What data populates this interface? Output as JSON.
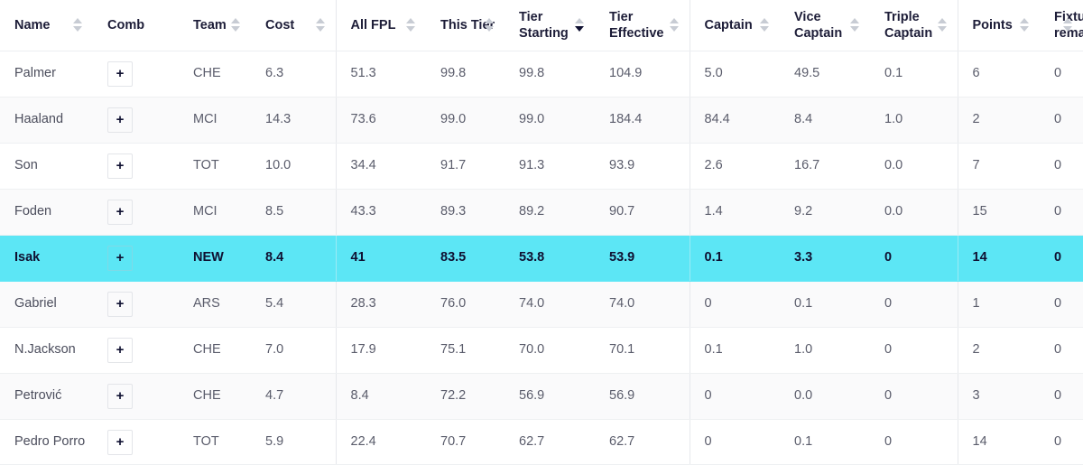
{
  "table": {
    "columns": [
      {
        "label": "Name",
        "sort": "none",
        "divider": false
      },
      {
        "label": "Comb",
        "sort": null,
        "divider": false
      },
      {
        "label": "Team",
        "sort": "none",
        "divider": false
      },
      {
        "label": "Cost",
        "sort": "none",
        "divider": true
      },
      {
        "label": "All FPL",
        "sort": "none",
        "divider": false
      },
      {
        "label": "This Tier",
        "sort": "none",
        "divider": false
      },
      {
        "label": "Tier\nStarting",
        "sort": "desc",
        "divider": false
      },
      {
        "label": "Tier\nEffective",
        "sort": "none",
        "divider": true
      },
      {
        "label": "Captain",
        "sort": "none",
        "divider": false
      },
      {
        "label": "Vice\nCaptain",
        "sort": "none",
        "divider": false
      },
      {
        "label": "Triple\nCaptain",
        "sort": "none",
        "divider": true
      },
      {
        "label": "Points",
        "sort": "none",
        "divider": false
      },
      {
        "label": "Fixtures\nremaining",
        "sort": "none",
        "divider": false
      }
    ],
    "add_button_label": "+",
    "highlight_color": "#5ce6f5",
    "rows": [
      {
        "name": "Palmer",
        "team": "CHE",
        "cost": "6.3",
        "all_fpl": "51.3",
        "this_tier": "99.8",
        "tier_starting": "99.8",
        "tier_effective": "104.9",
        "captain": "5.0",
        "vice_captain": "49.5",
        "triple_captain": "0.1",
        "points": "6",
        "fixtures_remaining": "0",
        "highlighted": false
      },
      {
        "name": "Haaland",
        "team": "MCI",
        "cost": "14.3",
        "all_fpl": "73.6",
        "this_tier": "99.0",
        "tier_starting": "99.0",
        "tier_effective": "184.4",
        "captain": "84.4",
        "vice_captain": "8.4",
        "triple_captain": "1.0",
        "points": "2",
        "fixtures_remaining": "0",
        "highlighted": false
      },
      {
        "name": "Son",
        "team": "TOT",
        "cost": "10.0",
        "all_fpl": "34.4",
        "this_tier": "91.7",
        "tier_starting": "91.3",
        "tier_effective": "93.9",
        "captain": "2.6",
        "vice_captain": "16.7",
        "triple_captain": "0.0",
        "points": "7",
        "fixtures_remaining": "0",
        "highlighted": false
      },
      {
        "name": "Foden",
        "team": "MCI",
        "cost": "8.5",
        "all_fpl": "43.3",
        "this_tier": "89.3",
        "tier_starting": "89.2",
        "tier_effective": "90.7",
        "captain": "1.4",
        "vice_captain": "9.2",
        "triple_captain": "0.0",
        "points": "15",
        "fixtures_remaining": "0",
        "highlighted": false
      },
      {
        "name": "Isak",
        "team": "NEW",
        "cost": "8.4",
        "all_fpl": "41",
        "this_tier": "83.5",
        "tier_starting": "53.8",
        "tier_effective": "53.9",
        "captain": "0.1",
        "vice_captain": "3.3",
        "triple_captain": "0",
        "points": "14",
        "fixtures_remaining": "0",
        "highlighted": true
      },
      {
        "name": "Gabriel",
        "team": "ARS",
        "cost": "5.4",
        "all_fpl": "28.3",
        "this_tier": "76.0",
        "tier_starting": "74.0",
        "tier_effective": "74.0",
        "captain": "0",
        "vice_captain": "0.1",
        "triple_captain": "0",
        "points": "1",
        "fixtures_remaining": "0",
        "highlighted": false
      },
      {
        "name": "N.Jackson",
        "team": "CHE",
        "cost": "7.0",
        "all_fpl": "17.9",
        "this_tier": "75.1",
        "tier_starting": "70.0",
        "tier_effective": "70.1",
        "captain": "0.1",
        "vice_captain": "1.0",
        "triple_captain": "0",
        "points": "2",
        "fixtures_remaining": "0",
        "highlighted": false
      },
      {
        "name": "Petrović",
        "team": "CHE",
        "cost": "4.7",
        "all_fpl": "8.4",
        "this_tier": "72.2",
        "tier_starting": "56.9",
        "tier_effective": "56.9",
        "captain": "0",
        "vice_captain": "0.0",
        "triple_captain": "0",
        "points": "3",
        "fixtures_remaining": "0",
        "highlighted": false
      },
      {
        "name": "Pedro Porro",
        "team": "TOT",
        "cost": "5.9",
        "all_fpl": "22.4",
        "this_tier": "70.7",
        "tier_starting": "62.7",
        "tier_effective": "62.7",
        "captain": "0",
        "vice_captain": "0.1",
        "triple_captain": "0",
        "points": "14",
        "fixtures_remaining": "0",
        "highlighted": false
      }
    ]
  }
}
